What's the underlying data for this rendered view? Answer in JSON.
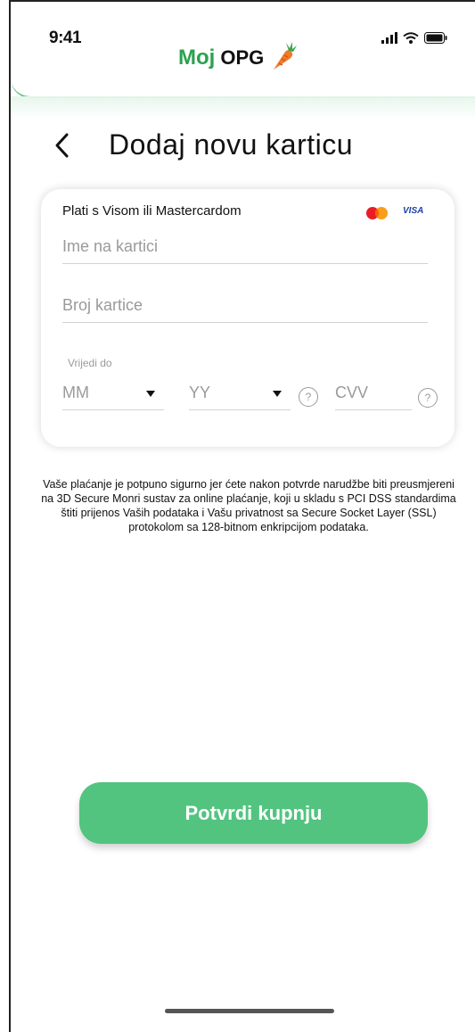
{
  "status_bar": {
    "time": "9:41"
  },
  "logo": {
    "moj": "Moj",
    "opg": "OPG"
  },
  "page": {
    "title": "Dodaj novu karticu"
  },
  "card": {
    "title": "Plati s Visom ili Mastercardom",
    "visa_label": "VISA",
    "fields": {
      "name_placeholder": "Ime na kartici",
      "number_placeholder": "Broj kartice",
      "valid_label": "Vrijedi do",
      "month_placeholder": "MM",
      "year_placeholder": "YY",
      "cvv_placeholder": "CVV",
      "help_symbol": "?"
    }
  },
  "secure_note": "Vaše plaćanje je potpuno sigurno jer ćete nakon potvrde narudžbe biti preusmjereni na 3D Secure Monri sustav za online plaćanje, koji u skladu s PCI DSS standardima štiti prijenos Vaših podataka i Vašu privatnost sa Secure Socket Layer (SSL) protokolom sa 128-bitnom enkripcijom podataka.",
  "actions": {
    "confirm_label": "Potvrdi kupnju"
  },
  "colors": {
    "brand_green": "#2aa24f",
    "button_green": "#52c47f",
    "visa_blue": "#1a3ea8"
  }
}
